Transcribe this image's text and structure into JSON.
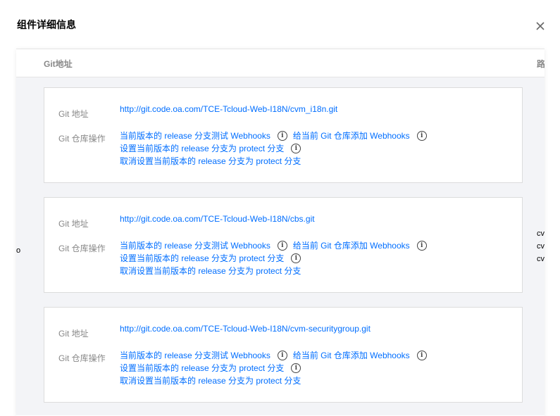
{
  "dialog": {
    "title": "组件详细信息"
  },
  "table": {
    "col_git": "Git地址",
    "col_path": "路",
    "left_mark": "o",
    "path_values": [
      "cv",
      "cv",
      "cv"
    ]
  },
  "labels": {
    "git_address": "Git 地址",
    "repo_ops": "Git 仓库操作"
  },
  "ops": {
    "test_webhooks": "当前版本的 release 分支测试 Webhooks",
    "add_webhooks": "给当前 Git 仓库添加 Webhooks",
    "set_protect": "设置当前版本的 release 分支为 protect 分支",
    "unset_protect": "取消设置当前版本的 release 分支为 protect 分支"
  },
  "repos": [
    {
      "url": "http://git.code.oa.com/TCE-Tcloud-Web-I18N/cvm_i18n.git"
    },
    {
      "url": "http://git.code.oa.com/TCE-Tcloud-Web-I18N/cbs.git"
    },
    {
      "url": "http://git.code.oa.com/TCE-Tcloud-Web-I18N/cvm-securitygroup.git"
    }
  ]
}
